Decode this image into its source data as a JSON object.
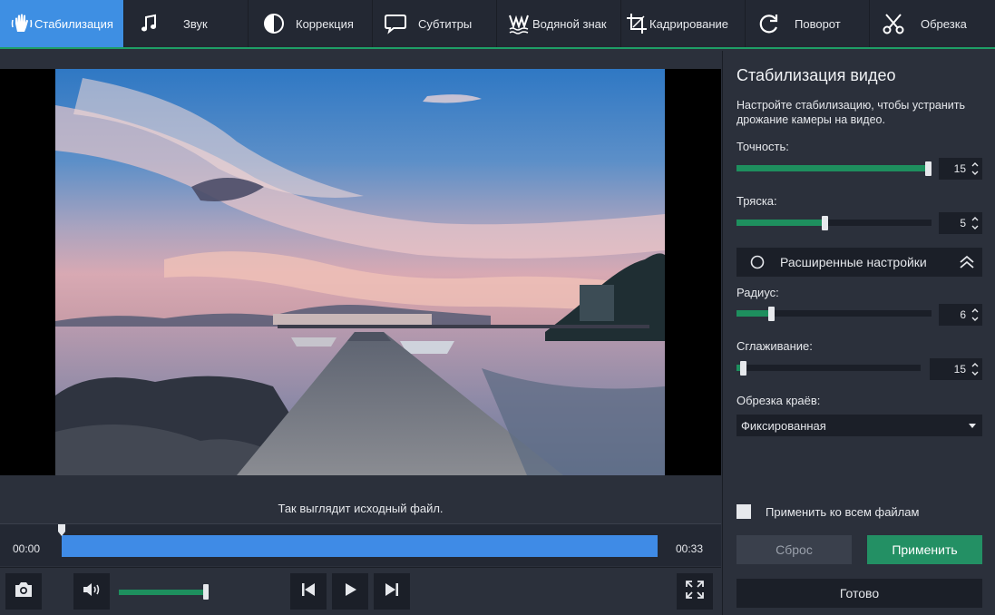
{
  "toolbar": {
    "tabs": [
      {
        "label": "Стабилизация",
        "icon": "hand-stabilize-icon",
        "active": true
      },
      {
        "label": "Звук",
        "icon": "music-note-icon"
      },
      {
        "label": "Коррекция",
        "icon": "half-circle-contrast-icon"
      },
      {
        "label": "Субтитры",
        "icon": "speech-bubble-icon"
      },
      {
        "label": "Водяной знак",
        "icon": "watermark-icon"
      },
      {
        "label": "Кадрирование",
        "icon": "crop-icon"
      },
      {
        "label": "Поворот",
        "icon": "rotate-icon"
      },
      {
        "label": "Обрезка",
        "icon": "scissors-icon"
      }
    ]
  },
  "preview": {
    "caption": "Так выглядит исходный файл."
  },
  "timeline": {
    "start_time": "00:00",
    "end_time": "00:33",
    "playhead_fraction": 0.0
  },
  "controls": {
    "snapshot_icon": "camera-icon",
    "volume_icon": "speaker-icon",
    "volume_level": 0.97,
    "prev_icon": "skip-previous-icon",
    "play_icon": "play-icon",
    "next_icon": "skip-next-icon",
    "fullscreen_icon": "fullscreen-icon"
  },
  "panel": {
    "title": "Стабилизация видео",
    "description": "Настройте стабилизацию, чтобы устранить дрожание камеры на видео.",
    "accuracy": {
      "label": "Точность:",
      "value": "15",
      "fraction": 1.0
    },
    "shake": {
      "label": "Тряска:",
      "value": "5",
      "fraction": 0.45
    },
    "advanced_label": "Расширенные настройки",
    "radius": {
      "label": "Радиус:",
      "value": "6",
      "fraction": 0.17
    },
    "smoothing": {
      "label": "Сглаживание:",
      "value": "15",
      "fraction": 0.02
    },
    "edge_crop_label": "Обрезка краёв:",
    "edge_crop_value": "Фиксированная",
    "apply_all_label": "Применить ко всем файлам",
    "reset_label": "Сброс",
    "apply_label": "Применить",
    "done_label": "Готово"
  },
  "colors": {
    "accent_blue": "#3e8fe3",
    "accent_green": "#1e8f5e",
    "panel_bg": "#2b303b",
    "dark_field": "#1b1f28"
  }
}
